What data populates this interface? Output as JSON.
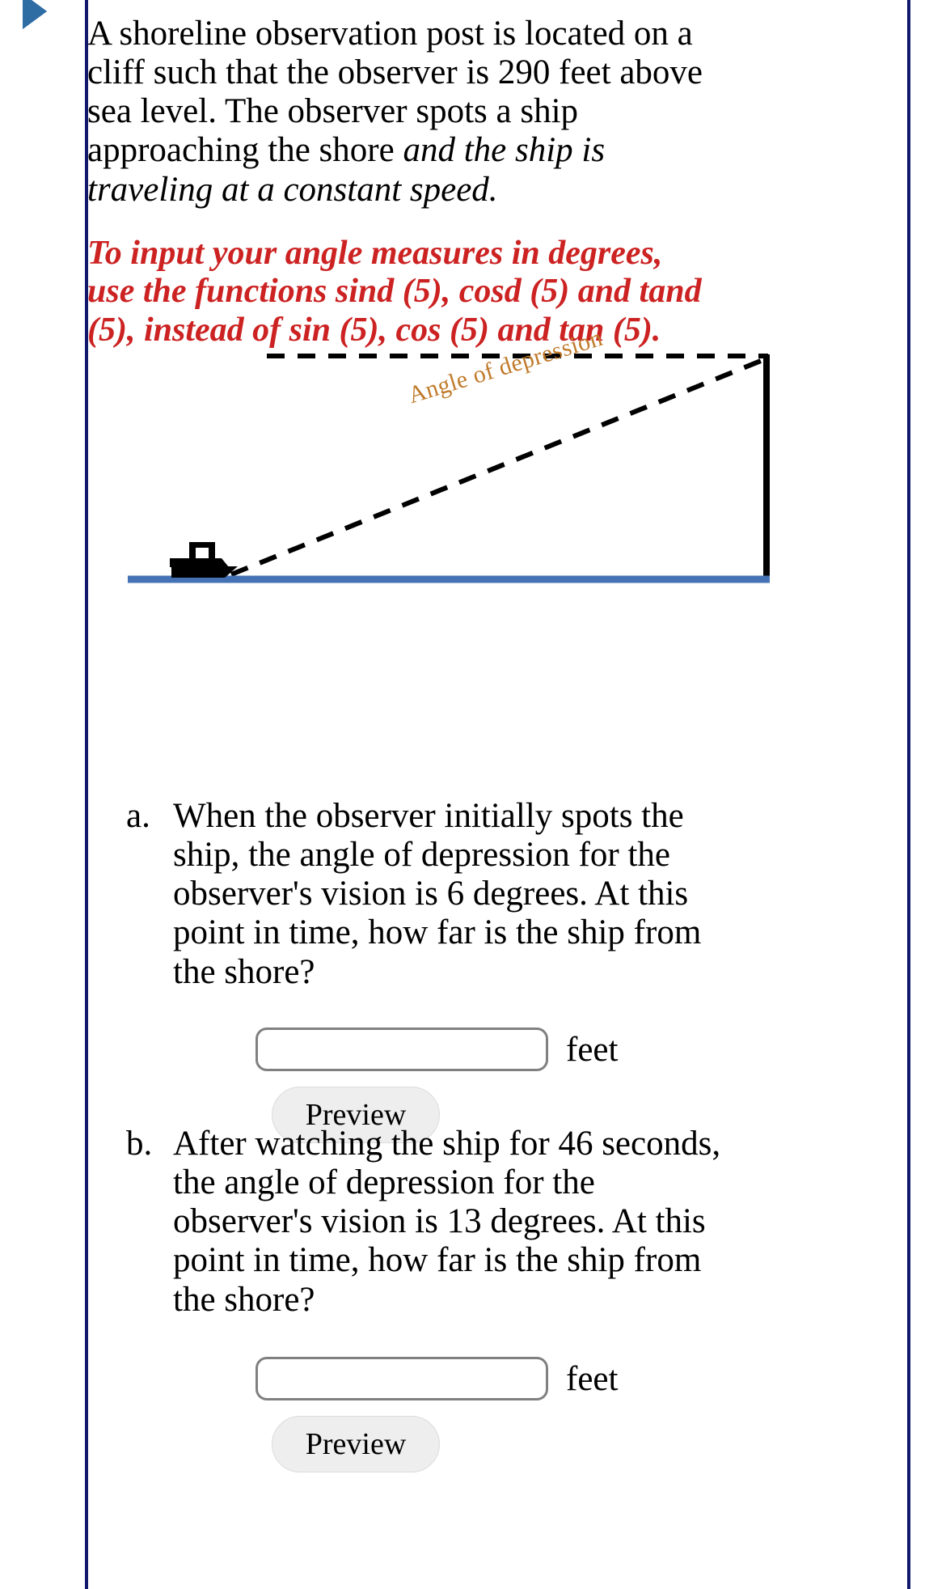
{
  "window": {
    "expand_icon": "triangle-right-icon",
    "border_color": "#10196b",
    "scrollbar_color": "#e8e8e8"
  },
  "problem": {
    "statement_plain": "A shoreline observation post is located on a cliff such that the observer is 290 feet above sea level. The observer spots a ship approaching the shore",
    "statement_italic": "and the ship is traveling at a constant speed.",
    "observer_height_feet": 290,
    "note": {
      "text": "To input your angle measures in degrees, use the functions sind (5), cosd (5) and tand (5), instead of sin (5), cos (5) and tan (5).",
      "color": "#cc2222"
    }
  },
  "diagram": {
    "angle_label": "Angle of depression",
    "angle_label_color": "#c07a2a",
    "water_line_color": "#4472b4",
    "cliff_line_color": "#000000",
    "ship_icon": "ship-silhouette-icon",
    "sight_line_style": "dashed",
    "horizontal_line_style": "dashed"
  },
  "parts": [
    {
      "marker": "a.",
      "question": "When the observer initially spots the ship, the angle of depression for the observer's vision is 6 degrees. At this point in time, how far is the ship from the shore?",
      "angle_degrees": 6,
      "input_value": "",
      "input_placeholder": "",
      "unit": "feet",
      "preview_label": "Preview"
    },
    {
      "marker": "b.",
      "question": "After watching the ship for 46 seconds, the angle of depression for the observer's vision is 13 degrees. At this point in time, how far is the ship from the shore?",
      "angle_degrees": 13,
      "elapsed_seconds": 46,
      "input_value": "",
      "input_placeholder": "",
      "unit": "feet",
      "preview_label": "Preview"
    }
  ]
}
